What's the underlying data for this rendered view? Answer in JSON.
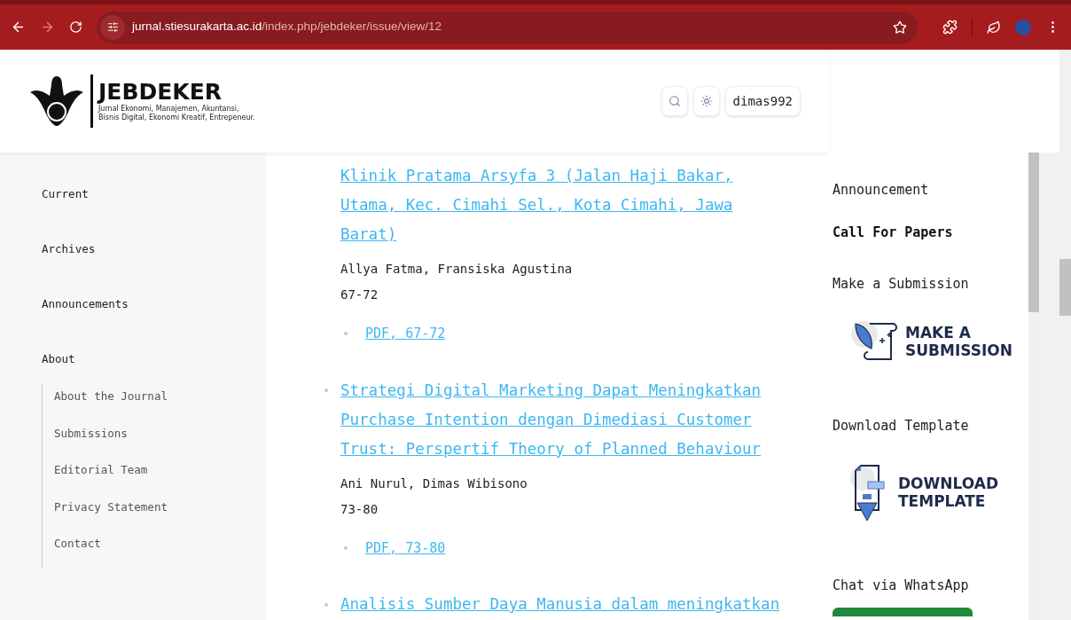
{
  "browser": {
    "url_host": "jurnal.stiesurakarta.ac.id",
    "url_path": "/index.php/jebdeker/issue/view/12"
  },
  "header": {
    "logo_title": "JEBDEKER",
    "logo_subtitle": [
      "Jurnal Ekonomi, Manajemen, Akuntansi,",
      "Bisnis Digital, Ekonomi Kreatif, Entrepeneur."
    ],
    "user": "dimas992"
  },
  "nav": [
    {
      "label": "Current"
    },
    {
      "label": "Archives"
    },
    {
      "label": "Announcements"
    },
    {
      "label": "About",
      "children": [
        {
          "label": "About the Journal"
        },
        {
          "label": "Submissions"
        },
        {
          "label": "Editorial Team"
        },
        {
          "label": "Privacy Statement"
        },
        {
          "label": "Contact"
        }
      ]
    }
  ],
  "articles": [
    {
      "title": "Klinik Pratama Arsyfa 3 (Jalan Haji Bakar, Utama, Kec. Cimahi Sel., Kota Cimahi, Jawa Barat)",
      "continued": true,
      "authors": "Allya Fatma, Fransiska Agustina",
      "pages": "67-72",
      "galleys": [
        "PDF, 67-72"
      ]
    },
    {
      "title": "Strategi Digital Marketing Dapat Meningkatkan Purchase Intention dengan Dimediasi Customer Trust: Perspertif Theory of Planned Behaviour",
      "continued": false,
      "authors": "Ani Nurul, Dimas Wibisono",
      "pages": "73-80",
      "galleys": [
        "PDF, 73-80"
      ]
    },
    {
      "title": "Analisis Sumber Daya Manusia dalam meningkatkan",
      "continued": false
    }
  ],
  "sidebar": [
    {
      "kind": "heading",
      "text": "Announcement"
    },
    {
      "kind": "link",
      "text": "Call For Papers"
    },
    {
      "kind": "heading",
      "text": "Make a Submission"
    },
    {
      "kind": "submission-banner",
      "lines": [
        "MAKE A",
        "SUBMISSION"
      ]
    },
    {
      "kind": "heading",
      "text": "Download Template"
    },
    {
      "kind": "template-banner",
      "lines": [
        "DOWNLOAD",
        "TEMPLATE"
      ]
    },
    {
      "kind": "heading",
      "text": "Chat via WhatsApp"
    },
    {
      "kind": "whatsapp"
    }
  ]
}
